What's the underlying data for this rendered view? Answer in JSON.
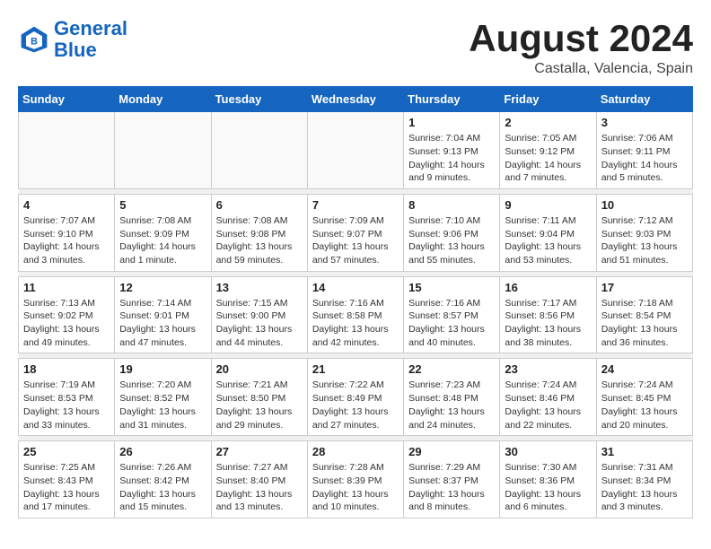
{
  "header": {
    "logo_general": "General",
    "logo_blue": "Blue",
    "month": "August 2024",
    "location": "Castalla, Valencia, Spain"
  },
  "weekdays": [
    "Sunday",
    "Monday",
    "Tuesday",
    "Wednesday",
    "Thursday",
    "Friday",
    "Saturday"
  ],
  "weeks": [
    [
      {
        "day": "",
        "info": ""
      },
      {
        "day": "",
        "info": ""
      },
      {
        "day": "",
        "info": ""
      },
      {
        "day": "",
        "info": ""
      },
      {
        "day": "1",
        "info": "Sunrise: 7:04 AM\nSunset: 9:13 PM\nDaylight: 14 hours\nand 9 minutes."
      },
      {
        "day": "2",
        "info": "Sunrise: 7:05 AM\nSunset: 9:12 PM\nDaylight: 14 hours\nand 7 minutes."
      },
      {
        "day": "3",
        "info": "Sunrise: 7:06 AM\nSunset: 9:11 PM\nDaylight: 14 hours\nand 5 minutes."
      }
    ],
    [
      {
        "day": "4",
        "info": "Sunrise: 7:07 AM\nSunset: 9:10 PM\nDaylight: 14 hours\nand 3 minutes."
      },
      {
        "day": "5",
        "info": "Sunrise: 7:08 AM\nSunset: 9:09 PM\nDaylight: 14 hours\nand 1 minute."
      },
      {
        "day": "6",
        "info": "Sunrise: 7:08 AM\nSunset: 9:08 PM\nDaylight: 13 hours\nand 59 minutes."
      },
      {
        "day": "7",
        "info": "Sunrise: 7:09 AM\nSunset: 9:07 PM\nDaylight: 13 hours\nand 57 minutes."
      },
      {
        "day": "8",
        "info": "Sunrise: 7:10 AM\nSunset: 9:06 PM\nDaylight: 13 hours\nand 55 minutes."
      },
      {
        "day": "9",
        "info": "Sunrise: 7:11 AM\nSunset: 9:04 PM\nDaylight: 13 hours\nand 53 minutes."
      },
      {
        "day": "10",
        "info": "Sunrise: 7:12 AM\nSunset: 9:03 PM\nDaylight: 13 hours\nand 51 minutes."
      }
    ],
    [
      {
        "day": "11",
        "info": "Sunrise: 7:13 AM\nSunset: 9:02 PM\nDaylight: 13 hours\nand 49 minutes."
      },
      {
        "day": "12",
        "info": "Sunrise: 7:14 AM\nSunset: 9:01 PM\nDaylight: 13 hours\nand 47 minutes."
      },
      {
        "day": "13",
        "info": "Sunrise: 7:15 AM\nSunset: 9:00 PM\nDaylight: 13 hours\nand 44 minutes."
      },
      {
        "day": "14",
        "info": "Sunrise: 7:16 AM\nSunset: 8:58 PM\nDaylight: 13 hours\nand 42 minutes."
      },
      {
        "day": "15",
        "info": "Sunrise: 7:16 AM\nSunset: 8:57 PM\nDaylight: 13 hours\nand 40 minutes."
      },
      {
        "day": "16",
        "info": "Sunrise: 7:17 AM\nSunset: 8:56 PM\nDaylight: 13 hours\nand 38 minutes."
      },
      {
        "day": "17",
        "info": "Sunrise: 7:18 AM\nSunset: 8:54 PM\nDaylight: 13 hours\nand 36 minutes."
      }
    ],
    [
      {
        "day": "18",
        "info": "Sunrise: 7:19 AM\nSunset: 8:53 PM\nDaylight: 13 hours\nand 33 minutes."
      },
      {
        "day": "19",
        "info": "Sunrise: 7:20 AM\nSunset: 8:52 PM\nDaylight: 13 hours\nand 31 minutes."
      },
      {
        "day": "20",
        "info": "Sunrise: 7:21 AM\nSunset: 8:50 PM\nDaylight: 13 hours\nand 29 minutes."
      },
      {
        "day": "21",
        "info": "Sunrise: 7:22 AM\nSunset: 8:49 PM\nDaylight: 13 hours\nand 27 minutes."
      },
      {
        "day": "22",
        "info": "Sunrise: 7:23 AM\nSunset: 8:48 PM\nDaylight: 13 hours\nand 24 minutes."
      },
      {
        "day": "23",
        "info": "Sunrise: 7:24 AM\nSunset: 8:46 PM\nDaylight: 13 hours\nand 22 minutes."
      },
      {
        "day": "24",
        "info": "Sunrise: 7:24 AM\nSunset: 8:45 PM\nDaylight: 13 hours\nand 20 minutes."
      }
    ],
    [
      {
        "day": "25",
        "info": "Sunrise: 7:25 AM\nSunset: 8:43 PM\nDaylight: 13 hours\nand 17 minutes."
      },
      {
        "day": "26",
        "info": "Sunrise: 7:26 AM\nSunset: 8:42 PM\nDaylight: 13 hours\nand 15 minutes."
      },
      {
        "day": "27",
        "info": "Sunrise: 7:27 AM\nSunset: 8:40 PM\nDaylight: 13 hours\nand 13 minutes."
      },
      {
        "day": "28",
        "info": "Sunrise: 7:28 AM\nSunset: 8:39 PM\nDaylight: 13 hours\nand 10 minutes."
      },
      {
        "day": "29",
        "info": "Sunrise: 7:29 AM\nSunset: 8:37 PM\nDaylight: 13 hours\nand 8 minutes."
      },
      {
        "day": "30",
        "info": "Sunrise: 7:30 AM\nSunset: 8:36 PM\nDaylight: 13 hours\nand 6 minutes."
      },
      {
        "day": "31",
        "info": "Sunrise: 7:31 AM\nSunset: 8:34 PM\nDaylight: 13 hours\nand 3 minutes."
      }
    ]
  ]
}
